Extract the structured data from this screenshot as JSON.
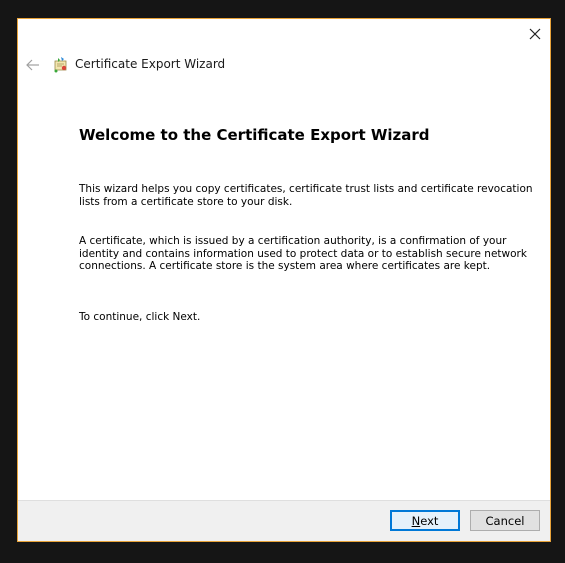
{
  "window": {
    "title": "Certificate Export Wizard",
    "close_icon": "close-icon",
    "back_icon": "back-arrow-icon",
    "wizard_icon": "certificate-wizard-icon"
  },
  "content": {
    "heading": "Welcome to the Certificate Export Wizard",
    "paragraph1": "This wizard helps you copy certificates, certificate trust lists and certificate revocation lists from a certificate store to your disk.",
    "paragraph2": "A certificate, which is issued by a certification authority, is a confirmation of your identity and contains information used to protect data or to establish secure network connections. A certificate store is the system area where certificates are kept.",
    "paragraph3": "To continue, click Next."
  },
  "footer": {
    "next_mnemonic": "N",
    "next_rest": "ext",
    "cancel_label": "Cancel"
  },
  "colors": {
    "accent": "#0078d7",
    "window_border": "#e8a33a",
    "footer_bg": "#f0f0f0"
  }
}
